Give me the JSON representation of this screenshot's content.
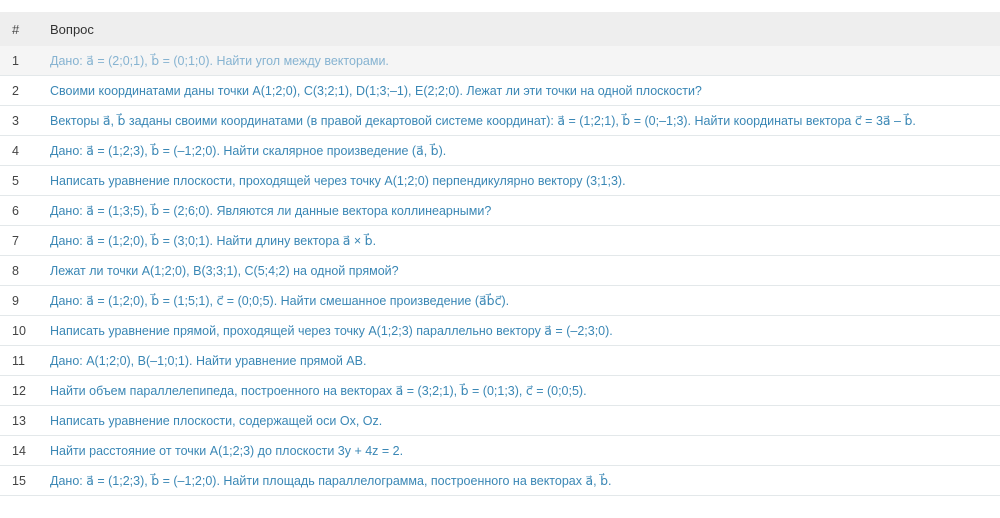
{
  "header": {
    "num": "#",
    "question": "Вопрос"
  },
  "rows": [
    {
      "n": "1",
      "text": "Дано: a⃗ = (2;0;1), b⃗ = (0;1;0). Найти угол между векторами."
    },
    {
      "n": "2",
      "text": "Своими координатами даны точки A(1;2;0), C(3;2;1), D(1;3;–1), E(2;2;0). Лежат ли эти точки на одной плоскости?"
    },
    {
      "n": "3",
      "text": "Векторы a⃗, b⃗ заданы своими координатами (в правой декартовой системе координат): a⃗ = (1;2;1), b⃗ = (0;–1;3). Найти координаты вектора c⃗ = 3a⃗ – b⃗."
    },
    {
      "n": "4",
      "text": "Дано: a⃗ = (1;2;3), b⃗ = (–1;2;0). Найти скалярное произведение (a⃗, b⃗)."
    },
    {
      "n": "5",
      "text": "Написать уравнение плоскости, проходящей через точку A(1;2;0) перпендикулярно вектору (3;1;3)."
    },
    {
      "n": "6",
      "text": "Дано: a⃗ = (1;3;5), b⃗ = (2;6;0). Являются ли данные вектора коллинеарными?"
    },
    {
      "n": "7",
      "text": "Дано: a⃗ = (1;2;0), b⃗ = (3;0;1). Найти длину вектора a⃗ × b⃗."
    },
    {
      "n": "8",
      "text": "Лежат ли точки A(1;2;0), B(3;3;1), C(5;4;2) на одной прямой?"
    },
    {
      "n": "9",
      "text": "Дано: a⃗ = (1;2;0), b⃗ = (1;5;1), c⃗ = (0;0;5). Найти смешанное произведение (a⃗b⃗c⃗)."
    },
    {
      "n": "10",
      "text": "Написать уравнение прямой, проходящей через точку A(1;2;3) параллельно вектору a⃗ = (–2;3;0)."
    },
    {
      "n": "11",
      "text": "Дано: A(1;2;0), B(–1;0;1). Найти уравнение прямой AB."
    },
    {
      "n": "12",
      "text": "Найти объем параллелепипеда, построенного на векторах a⃗ = (3;2;1), b⃗ = (0;1;3), c⃗ = (0;0;5)."
    },
    {
      "n": "13",
      "text": "Написать уравнение плоскости, содержащей оси Ox, Oz."
    },
    {
      "n": "14",
      "text": "Найти расстояние от точки A(1;2;3) до плоскости 3y + 4z = 2."
    },
    {
      "n": "15",
      "text": "Дано: a⃗ = (1;2;3), b⃗ = (–1;2;0). Найти площадь параллелограмма, построенного на векторах a⃗, b⃗."
    }
  ]
}
